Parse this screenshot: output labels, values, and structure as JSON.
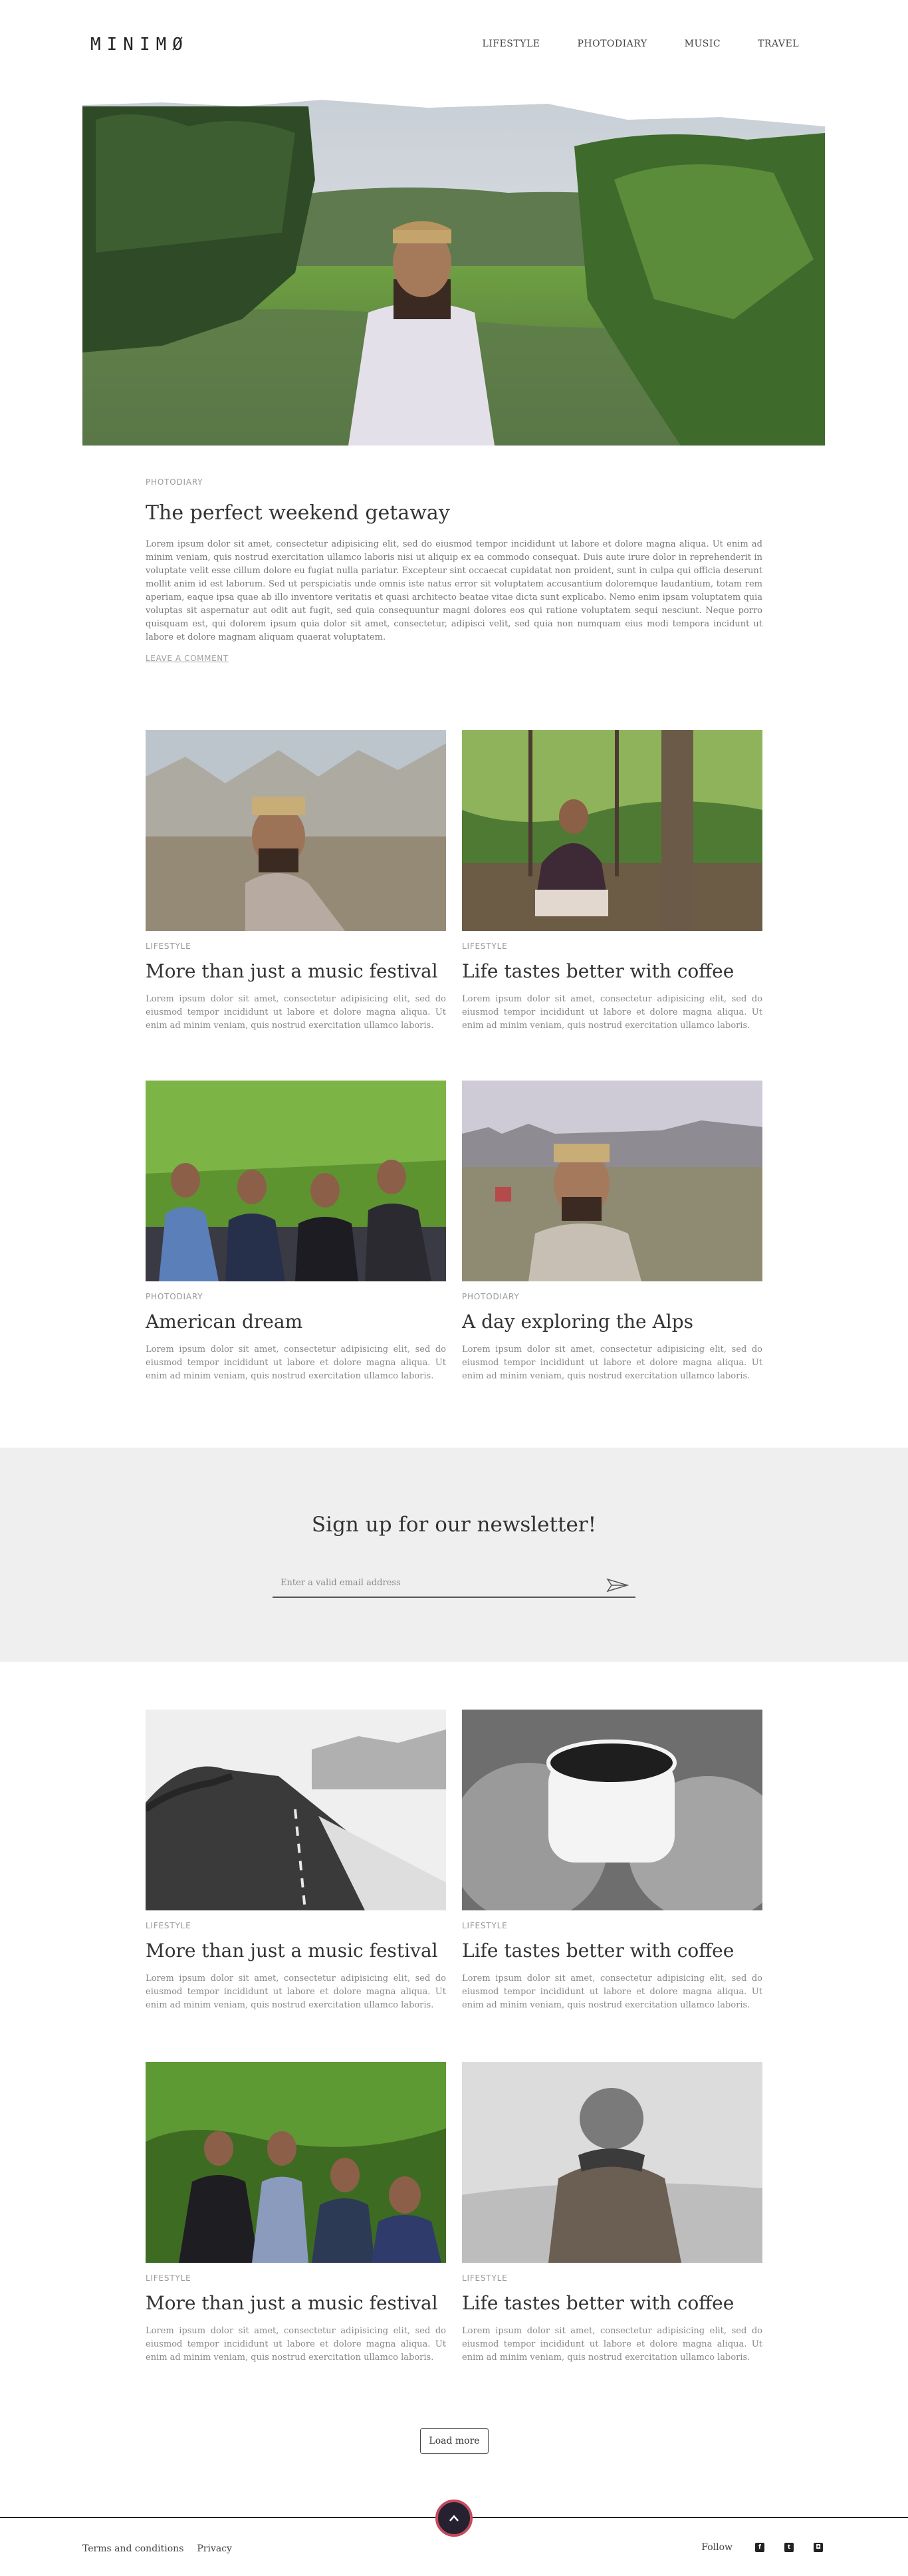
{
  "header": {
    "logo": "MINIMØ",
    "nav": [
      "LIFESTYLE",
      "PHOTODIARY",
      "MUSIC",
      "TRAVEL"
    ]
  },
  "feature": {
    "kicker": "PHOTODIARY",
    "title": "The perfect weekend getaway",
    "body": "Lorem ipsum dolor sit amet, consectetur adipisicing elit, sed do eiusmod tempor incididunt ut labore et dolore magna aliqua. Ut enim ad minim veniam, quis nostrud exercitation ullamco laboris nisi ut aliquip ex ea commodo consequat. Duis aute irure dolor in reprehenderit in voluptate velit esse cillum dolore eu fugiat nulla pariatur. Excepteur sint occaecat cupidatat non proident, sunt in culpa qui officia deserunt mollit anim id est laborum. Sed ut perspiciatis unde omnis iste natus error sit voluptatem accusantium doloremque laudantium, totam rem aperiam, eaque ipsa quae ab illo inventore veritatis et quasi architecto beatae vitae dicta sunt explicabo. Nemo enim ipsam voluptatem quia voluptas sit aspernatur aut odit aut fugit, sed quia consequuntur magni dolores eos qui ratione voluptatem sequi nesciunt. Neque porro quisquam est, qui dolorem ipsum quia dolor sit amet, consectetur, adipisci velit, sed quia non numquam eius modi tempora incidunt ut labore et dolore magnam aliquam quaerat voluptatem.",
    "comment_link": "LEAVE A COMMENT"
  },
  "posts": [
    {
      "kicker": "LIFESTYLE",
      "title": "More than just a music festival",
      "body": "Lorem ipsum dolor sit amet, consectetur adipisicing elit, sed do eiusmod tempor incididunt ut labore et dolore magna aliqua. Ut enim ad minim veniam, quis nostrud exercitation ullamco laboris."
    },
    {
      "kicker": "LIFESTYLE",
      "title": "Life tastes better with coffee",
      "body": "Lorem ipsum dolor sit amet, consectetur adipisicing elit, sed do eiusmod tempor incididunt ut labore et dolore magna aliqua. Ut enim ad minim veniam, quis nostrud exercitation ullamco laboris."
    },
    {
      "kicker": "PHOTODIARY",
      "title": "American dream",
      "body": "Lorem ipsum dolor sit amet, consectetur adipisicing elit, sed do eiusmod tempor incididunt ut labore et dolore magna aliqua. Ut enim ad minim veniam, quis nostrud exercitation ullamco laboris."
    },
    {
      "kicker": "PHOTODIARY",
      "title": "A day exploring the Alps",
      "body": "Lorem ipsum dolor sit amet, consectetur adipisicing elit, sed do eiusmod tempor incididunt ut labore et dolore magna aliqua. Ut enim ad minim veniam, quis nostrud exercitation ullamco laboris."
    },
    {
      "kicker": "LIFESTYLE",
      "title": "More than just a music festival",
      "body": "Lorem ipsum dolor sit amet, consectetur adipisicing elit, sed do eiusmod tempor incididunt ut labore et dolore magna aliqua. Ut enim ad minim veniam, quis nostrud exercitation ullamco laboris."
    },
    {
      "kicker": "LIFESTYLE",
      "title": "Life tastes better with coffee",
      "body": "Lorem ipsum dolor sit amet, consectetur adipisicing elit, sed do eiusmod tempor incididunt ut labore et dolore magna aliqua. Ut enim ad minim veniam, quis nostrud exercitation ullamco laboris."
    },
    {
      "kicker": "LIFESTYLE",
      "title": "More than just a music festival",
      "body": "Lorem ipsum dolor sit amet, consectetur adipisicing elit, sed do eiusmod tempor incididunt ut labore et dolore magna aliqua. Ut enim ad minim veniam, quis nostrud exercitation ullamco laboris."
    },
    {
      "kicker": "LIFESTYLE",
      "title": "Life tastes better with coffee",
      "body": "Lorem ipsum dolor sit amet, consectetur adipisicing elit, sed do eiusmod tempor incididunt ut labore et dolore magna aliqua. Ut enim ad minim veniam, quis nostrud exercitation ullamco laboris."
    }
  ],
  "newsletter": {
    "title": "Sign up for our newsletter!",
    "placeholder": "Enter a valid email address",
    "send_icon": "send-icon"
  },
  "load_more": "Load more",
  "footer": {
    "links": [
      "Terms and conditions",
      "Privacy"
    ],
    "follow_label": "Follow",
    "social_icons": [
      "facebook-icon",
      "twitter-icon",
      "instagram-icon"
    ],
    "scroll_top_icon": "chevron-up-icon"
  },
  "colors": {
    "accent": "#c44a5e",
    "dark": "#262130",
    "newsletter_bg": "#efefef"
  }
}
